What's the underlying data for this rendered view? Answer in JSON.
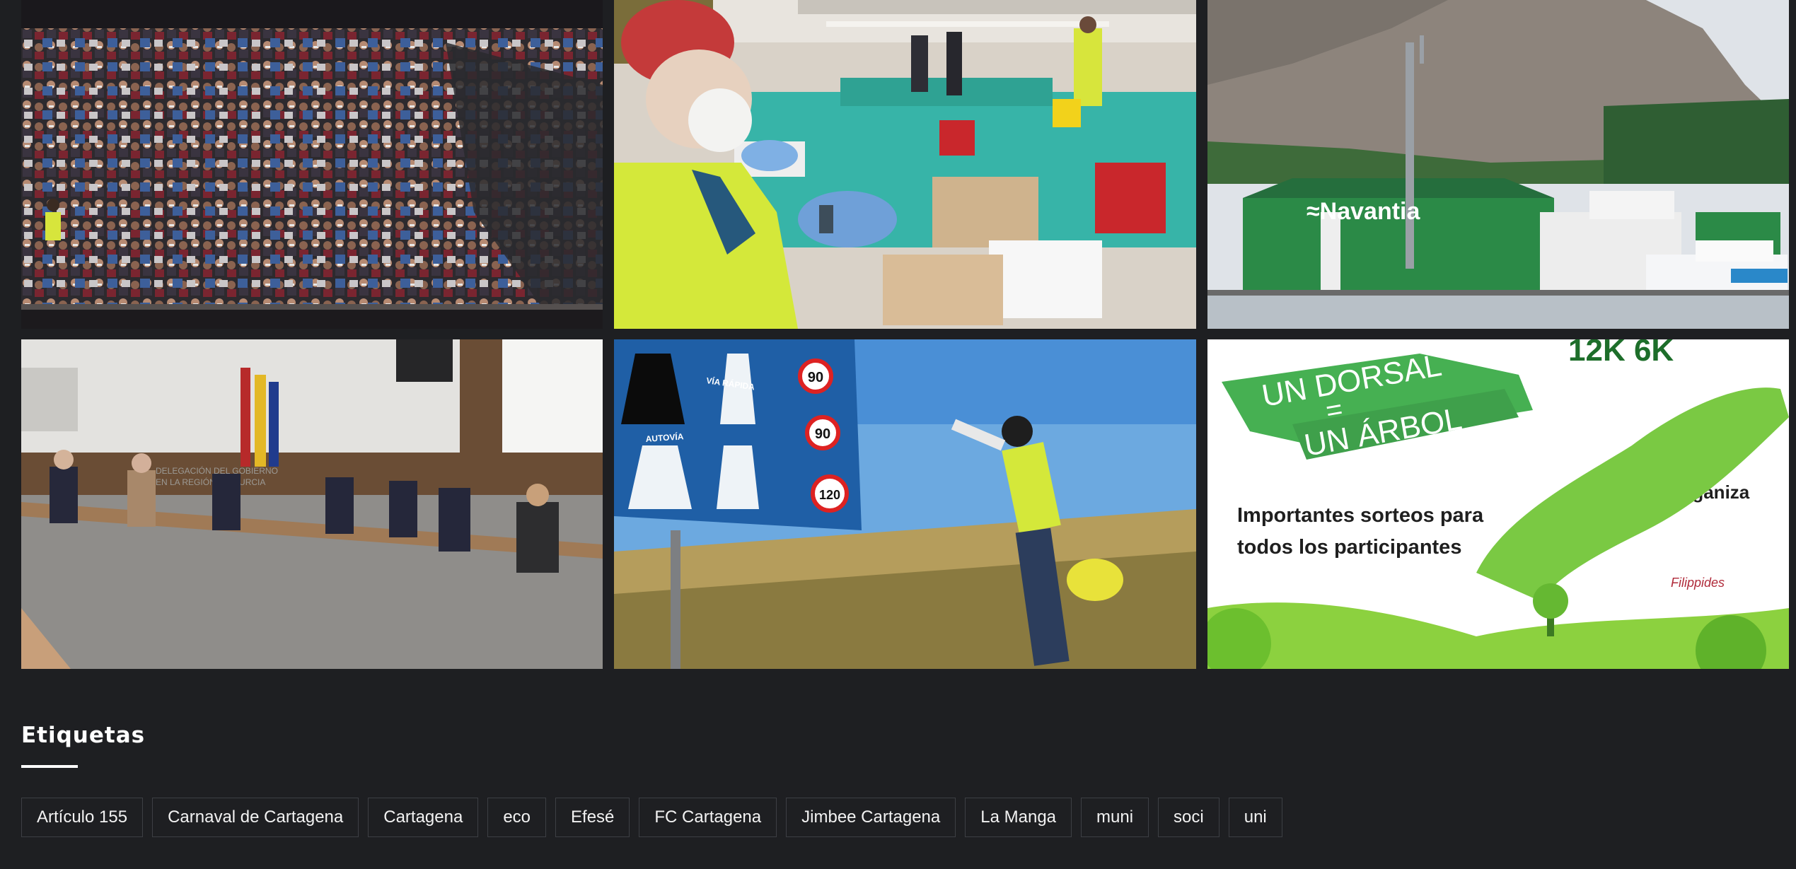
{
  "gallery": {
    "items": [
      {
        "name": "crowd-stands-photo"
      },
      {
        "name": "vaccination-photo"
      },
      {
        "name": "navantia-shipyard-photo",
        "sign_text": "≈Navantia"
      },
      {
        "name": "official-meeting-photo",
        "wall_text_1": "DELEGACIÓN DEL GOBIERNO",
        "wall_text_2": "EN LA REGIÓN DE MURCIA"
      },
      {
        "name": "road-sign-photo",
        "sign_vr": "VÍA RÁPIDA",
        "sign_autovia": "AUTOVÍA",
        "speed_1": "90",
        "speed_2": "90",
        "speed_3": "120"
      },
      {
        "name": "race-poster-photo",
        "banner_1": "UN DORSAL",
        "banner_eq": "=",
        "banner_2": "UN ÁRBOL",
        "distance_text": "12K     6K",
        "line_1": "Importantes sorteos para",
        "line_2": "todos los participantes",
        "organiza": "Organiza",
        "org_name": "Filippides"
      }
    ]
  },
  "tags": {
    "title": "Etiquetas",
    "items": [
      "Artículo 155",
      "Carnaval de Cartagena",
      "Cartagena",
      "eco",
      "Efesé",
      "FC Cartagena",
      "Jimbee Cartagena",
      "La Manga",
      "muni",
      "soci",
      "uni"
    ]
  },
  "colors": {
    "background": "#1e1f22",
    "tag_border": "#3d3f44",
    "text": "#ffffff"
  }
}
